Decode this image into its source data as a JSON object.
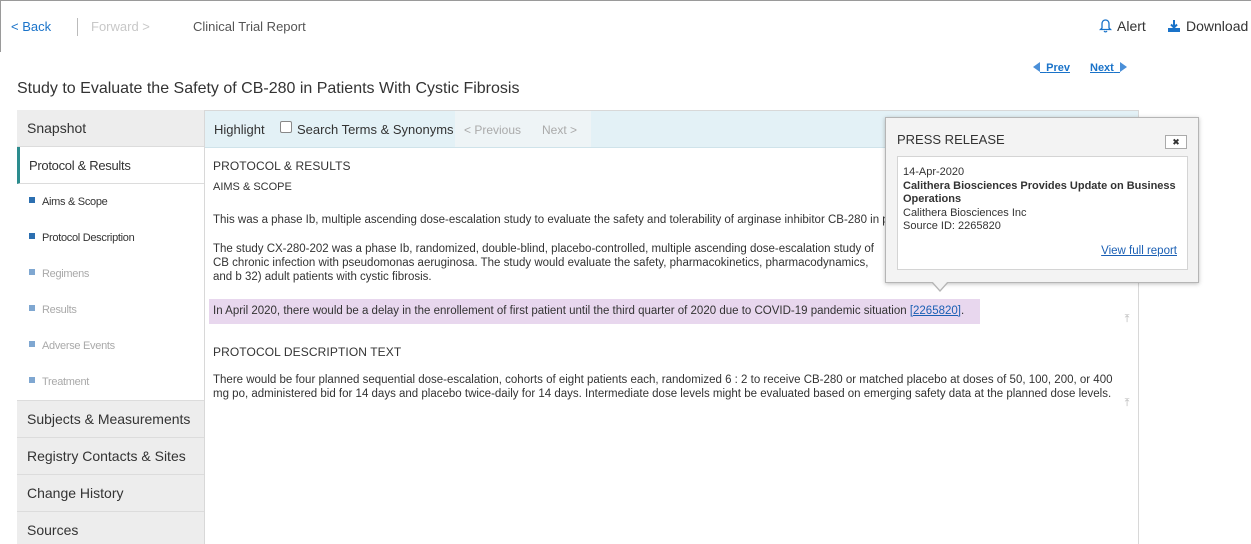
{
  "nav": {
    "back": "< Back",
    "forward": "Forward >",
    "title": "Clinical Trial Report",
    "alert": "Alert",
    "download": "Download",
    "prev": "Prev",
    "next": "Next"
  },
  "study_title": "Study to Evaluate the Safety of CB-280 in Patients With Cystic Fibrosis",
  "sidebar": {
    "snapshot": "Snapshot",
    "protocol_results": "Protocol & Results",
    "sub_items": [
      {
        "label": "Aims & Scope",
        "enabled": true
      },
      {
        "label": "Protocol Description",
        "enabled": true
      },
      {
        "label": "Regimens",
        "enabled": false
      },
      {
        "label": "Results",
        "enabled": false
      },
      {
        "label": "Adverse Events",
        "enabled": false
      },
      {
        "label": "Treatment",
        "enabled": false
      }
    ],
    "subjects": "Subjects & Measurements",
    "registry": "Registry Contacts & Sites",
    "history": "Change History",
    "sources": "Sources"
  },
  "highlight_bar": {
    "label": "Highlight",
    "terms": "Search Terms & Synonyms",
    "prev": "< Previous",
    "next": "Next >"
  },
  "content": {
    "heading": "PROTOCOL & RESULTS",
    "subheading": "AIMS & SCOPE",
    "para1": "This was a phase Ib, multiple ascending dose-escalation study to evaluate the safety and tolerability of arginase inhibitor CB-280 in p",
    "para2": "The study CX-280-202 was a phase Ib, randomized, double-blind, placebo-controlled, multiple ascending dose-escalation study of CB chronic infection with pseudomonas aeruginosa. The study would evaluate the safety, pharmacokinetics, pharmacodynamics, and b 32) adult patients with cystic fibrosis.",
    "highlight_text": "In April 2020, there would be a delay in the enrollement of first patient until the third quarter of 2020 due to COVID-19 pandemic situation ",
    "highlight_ref": "[2265820]",
    "highlight_end": ".",
    "heading2": "PROTOCOL DESCRIPTION TEXT",
    "para3": "There would be four planned sequential dose-escalation, cohorts of eight patients each, randomized 6 : 2 to receive CB-280 or matched placebo at doses of 50, 100, 200, or 400 mg po, administered bid for 14 days and placebo twice-daily for 14 days. Intermediate dose levels might be evaluated based on emerging safety data at the planned dose levels."
  },
  "popup": {
    "title": "PRESS RELEASE",
    "close": "✖",
    "date": "14-Apr-2020",
    "headline": "Calithera Biosciences Provides Update on Business Operations",
    "company": "Calithera Biosciences Inc",
    "source": "Source ID: 2265820",
    "link": "View full report"
  }
}
